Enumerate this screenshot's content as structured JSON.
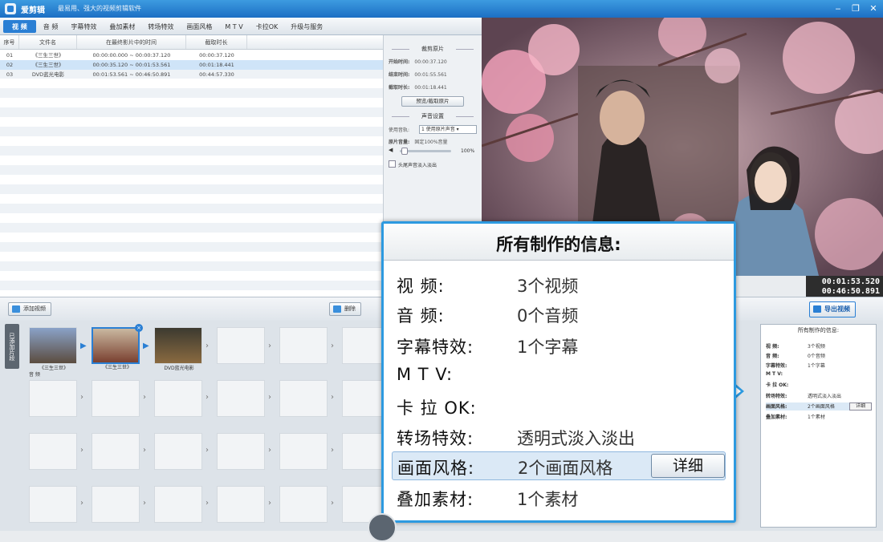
{
  "app": {
    "title": "爱剪辑",
    "subtitle": "最易用、强大的视频剪辑软件"
  },
  "tabs": [
    {
      "label": "视 频",
      "active": true
    },
    {
      "label": "音 频"
    },
    {
      "label": "字幕特效"
    },
    {
      "label": "叠加素材"
    },
    {
      "label": "转场特效"
    },
    {
      "label": "画面风格"
    },
    {
      "label": "M T V"
    },
    {
      "label": "卡拉OK"
    },
    {
      "label": "升级与服务"
    }
  ],
  "clip_table": {
    "columns": [
      "序号",
      "文件名",
      "在最终影片中的时间",
      "截取时长"
    ],
    "rows": [
      {
        "index": "01",
        "name": "《三生三世》",
        "time": "00:00:00.000 ~ 00:00:37.120",
        "dur": "00:00:37.120",
        "selected": false
      },
      {
        "index": "02",
        "name": "《三生三世》",
        "time": "00:00:35.120 ~ 00:01:53.561",
        "dur": "00:01:18.441",
        "selected": true
      },
      {
        "index": "03",
        "name": "DVD蓝光电影",
        "time": "00:01:53.561 ~ 00:46:50.891",
        "dur": "00:44:57.330",
        "selected": false
      }
    ]
  },
  "clip_settings": {
    "section_clip": "裁剪原片",
    "start_label": "开始时间:",
    "start_value": "00:00:37.120",
    "end_label": "结束时间:",
    "end_value": "00:01:55.561",
    "dur_label": "截取时长:",
    "dur_value": "00:01:18.441",
    "preview_button": "预览/截取原片",
    "section_audio": "声音设置",
    "track_label": "使用音轨:",
    "track_value": "1 使用原片声音",
    "vol_label": "原片音量:",
    "vol_value": "固定100%音量",
    "vol_max": "100%",
    "fade_label": "头尾声音淡入淡出",
    "fade_checked": false
  },
  "timecode": {
    "current": "00:01:53.520",
    "total": "00:46:50.891"
  },
  "toolbar": {
    "add_video": "添加视频",
    "delete": "删除",
    "export": "导出视频"
  },
  "storyboard": {
    "side_tab": "已添加片段",
    "audio_label": "音 频",
    "clips": [
      "《三生三世》",
      "《三生三世》",
      "DVD蓝光电影"
    ]
  },
  "info_popup": {
    "title": "所有制作的信息:",
    "rows": [
      {
        "label": "视    频:",
        "value": "3个视频"
      },
      {
        "label": "音    频:",
        "value": "0个音频"
      },
      {
        "label": "字幕特效:",
        "value": "1个字幕"
      },
      {
        "label": "M  T  V:",
        "value": ""
      },
      {
        "label": "卡 拉 OK:",
        "value": ""
      },
      {
        "label": "转场特效:",
        "value": "透明式淡入淡出"
      },
      {
        "label": "画面风格:",
        "value": "2个画面风格",
        "highlight": true
      },
      {
        "label": "叠加素材:",
        "value": "1个素材"
      }
    ],
    "detail_button": "详细"
  },
  "mini_info": {
    "title": "所有制作的信息:",
    "rows": [
      {
        "label": "视  频:",
        "value": "3个视频"
      },
      {
        "label": "音  频:",
        "value": "0个音频"
      },
      {
        "label": "字幕特效:",
        "value": "1个字幕"
      },
      {
        "label": "M T V:",
        "value": ""
      },
      {
        "label": "卡 拉 OK:",
        "value": ""
      },
      {
        "label": "转场特效:",
        "value": "透明式淡入淡出"
      },
      {
        "label": "画面风格:",
        "value": "2个画面风格"
      },
      {
        "label": "叠加素材:",
        "value": "1个素材"
      }
    ],
    "detail_button": "详细"
  },
  "colors": {
    "accent": "#2d9ae0",
    "title_bar": "#1c6fc4"
  }
}
